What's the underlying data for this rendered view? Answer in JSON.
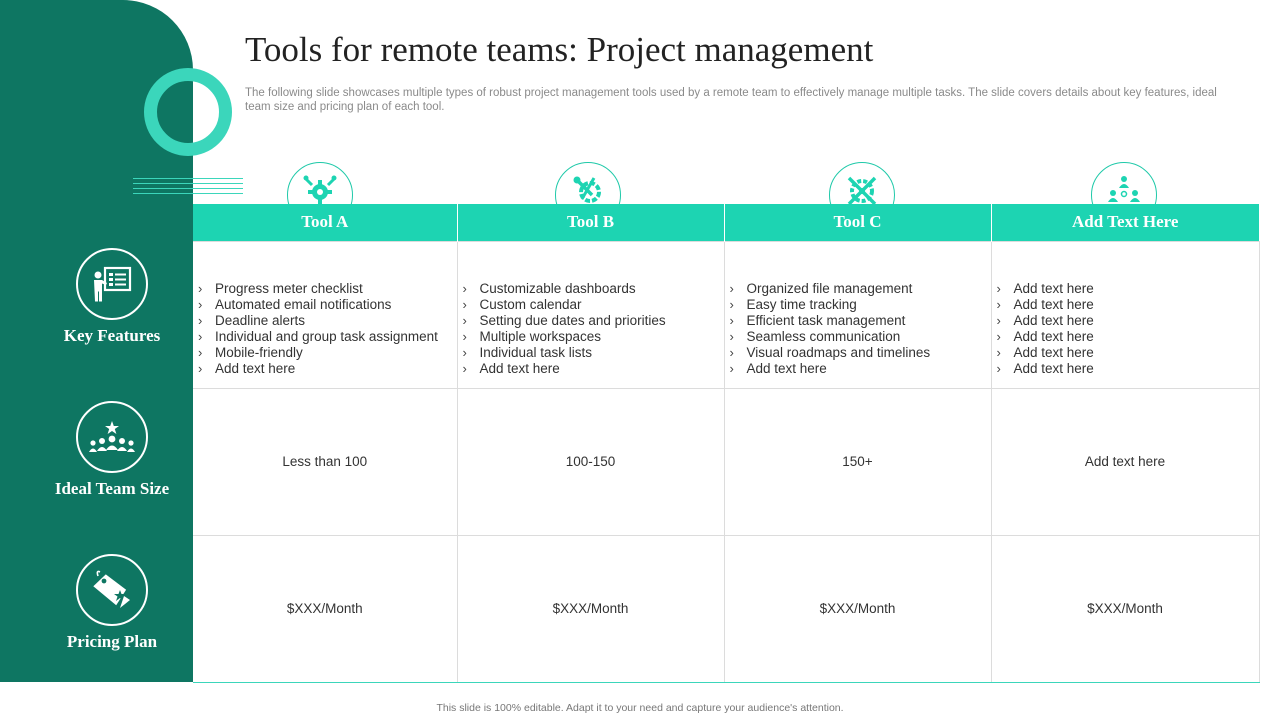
{
  "slide": {
    "title": "Tools for remote teams: Project management",
    "subtitle": "The following slide showcases multiple types of robust project management tools used by a remote team to effectively  manage multiple tasks. The slide covers details about key features, ideal team size and pricing plan of each tool.",
    "footer": "This slide is 100% editable.  Adapt it to your need and capture your audience's attention."
  },
  "colors": {
    "sidebar": "#0e7662",
    "accent": "#1dd4b2",
    "ring": "#3bd6bb"
  },
  "row_labels": [
    {
      "label": "Key Features",
      "icon": "presentation-board-icon"
    },
    {
      "label": "Ideal Team Size",
      "icon": "team-star-icon"
    },
    {
      "label": "Pricing Plan",
      "icon": "price-tag-icon"
    }
  ],
  "columns": [
    {
      "header": "Tool A",
      "icon": "gear-wrench-icon",
      "features": [
        "Progress meter checklist",
        "Automated email notifications",
        "Deadline  alerts",
        "Individual  and group task assignment",
        "Mobile-friendly",
        "Add text here"
      ],
      "team_size": "Less than 100",
      "pricing": "$XXX/Month"
    },
    {
      "header": "Tool B",
      "icon": "tools-gear-icon",
      "features": [
        "Customizable dashboards",
        "Custom calendar",
        "Setting due dates and priorities",
        "Multiple workspaces",
        "Individual  task lists",
        "Add text here"
      ],
      "team_size": "100-150",
      "pricing": "$XXX/Month"
    },
    {
      "header": "Tool C",
      "icon": "crossed-tools-gear-icon",
      "features": [
        "Organized file management",
        "Easy time tracking",
        "Efficient task management",
        "Seamless communication",
        "Visual roadmaps and timelines",
        "Add text here"
      ],
      "team_size": "150+",
      "pricing": "$XXX/Month"
    },
    {
      "header": "Add Text Here",
      "icon": "team-network-icon",
      "features": [
        "Add text here",
        "Add text here",
        "Add text here",
        "Add text here",
        "Add text here",
        "Add text here"
      ],
      "team_size": "Add text here",
      "pricing": "$XXX/Month"
    }
  ]
}
